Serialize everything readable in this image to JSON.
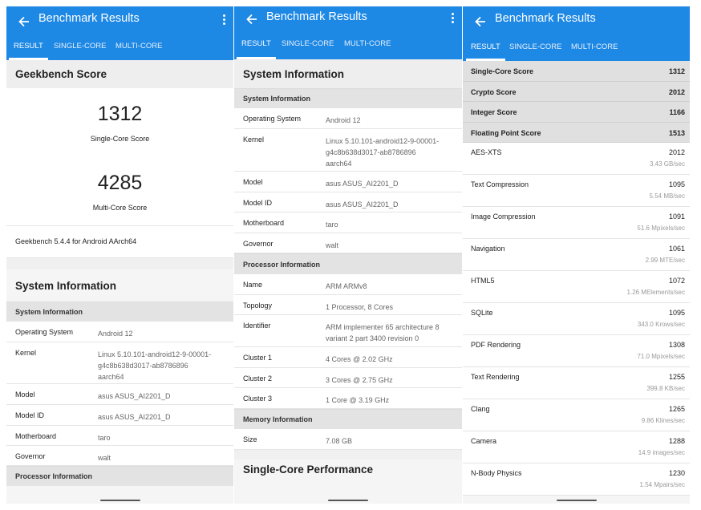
{
  "common": {
    "title": "Benchmark Results",
    "tabs": [
      "RESULT",
      "SINGLE-CORE",
      "MULTI-CORE"
    ],
    "accent_color": "#1e88e5"
  },
  "panel1": {
    "section_title": "Geekbench Score",
    "single_core_score": "1312",
    "single_core_label": "Single-Core Score",
    "multi_core_score": "4285",
    "multi_core_label": "Multi-Core Score",
    "version_text": "Geekbench 5.4.4 for Android AArch64",
    "system_info_title": "System Information",
    "system_info_header": "System Information",
    "rows": [
      {
        "key": "Operating System",
        "value": "Android 12"
      },
      {
        "key": "Kernel",
        "value": "Linux 5.10.101-android12-9-00001-\ng4c8b638d3017-ab8786896\naarch64"
      },
      {
        "key": "Model",
        "value": "asus ASUS_AI2201_D"
      },
      {
        "key": "Model ID",
        "value": "asus ASUS_AI2201_D"
      },
      {
        "key": "Motherboard",
        "value": "taro"
      },
      {
        "key": "Governor",
        "value": "walt"
      }
    ],
    "processor_info_header": "Processor Information"
  },
  "panel2": {
    "section_title": "System Information",
    "system_info_header": "System Information",
    "system_rows": [
      {
        "key": "Operating System",
        "value": "Android 12"
      },
      {
        "key": "Kernel",
        "value": "Linux 5.10.101-android12-9-00001-\ng4c8b638d3017-ab8786896\naarch64"
      },
      {
        "key": "Model",
        "value": "asus ASUS_AI2201_D"
      },
      {
        "key": "Model ID",
        "value": "asus ASUS_AI2201_D"
      },
      {
        "key": "Motherboard",
        "value": "taro"
      },
      {
        "key": "Governor",
        "value": "walt"
      }
    ],
    "processor_info_header": "Processor Information",
    "processor_rows": [
      {
        "key": "Name",
        "value": "ARM ARMv8"
      },
      {
        "key": "Topology",
        "value": "1 Processor, 8 Cores"
      },
      {
        "key": "Identifier",
        "value": "ARM implementer 65 architecture 8\nvariant 2 part 3400 revision 0"
      },
      {
        "key": "Cluster 1",
        "value": "4 Cores @ 2.02 GHz"
      },
      {
        "key": "Cluster 2",
        "value": "3 Cores @ 2.75 GHz"
      },
      {
        "key": "Cluster 3",
        "value": "1 Core @ 3.19 GHz"
      }
    ],
    "memory_info_header": "Memory Information",
    "memory_rows": [
      {
        "key": "Size",
        "value": "7.08 GB"
      }
    ],
    "single_core_perf_title": "Single-Core Performance"
  },
  "panel3": {
    "summary": [
      {
        "key": "Single-Core Score",
        "value": "1312"
      },
      {
        "key": "Crypto Score",
        "value": "2012"
      },
      {
        "key": "Integer Score",
        "value": "1166"
      },
      {
        "key": "Floating Point Score",
        "value": "1513"
      }
    ],
    "workloads": [
      {
        "key": "AES-XTS",
        "value": "2012",
        "rate": "3.43 GB/sec"
      },
      {
        "key": "Text Compression",
        "value": "1095",
        "rate": "5.54 MB/sec"
      },
      {
        "key": "Image Compression",
        "value": "1091",
        "rate": "51.6 Mpixels/sec"
      },
      {
        "key": "Navigation",
        "value": "1061",
        "rate": "2.99 MTE/sec"
      },
      {
        "key": "HTML5",
        "value": "1072",
        "rate": "1.26 MElements/sec"
      },
      {
        "key": "SQLite",
        "value": "1095",
        "rate": "343.0 Krows/sec"
      },
      {
        "key": "PDF Rendering",
        "value": "1308",
        "rate": "71.0 Mpixels/sec"
      },
      {
        "key": "Text Rendering",
        "value": "1255",
        "rate": "399.8 KB/sec"
      },
      {
        "key": "Clang",
        "value": "1265",
        "rate": "9.86 Klines/sec"
      },
      {
        "key": "Camera",
        "value": "1288",
        "rate": "14.9 images/sec"
      },
      {
        "key": "N-Body Physics",
        "value": "1230",
        "rate": "1.54 Mpairs/sec"
      }
    ]
  }
}
